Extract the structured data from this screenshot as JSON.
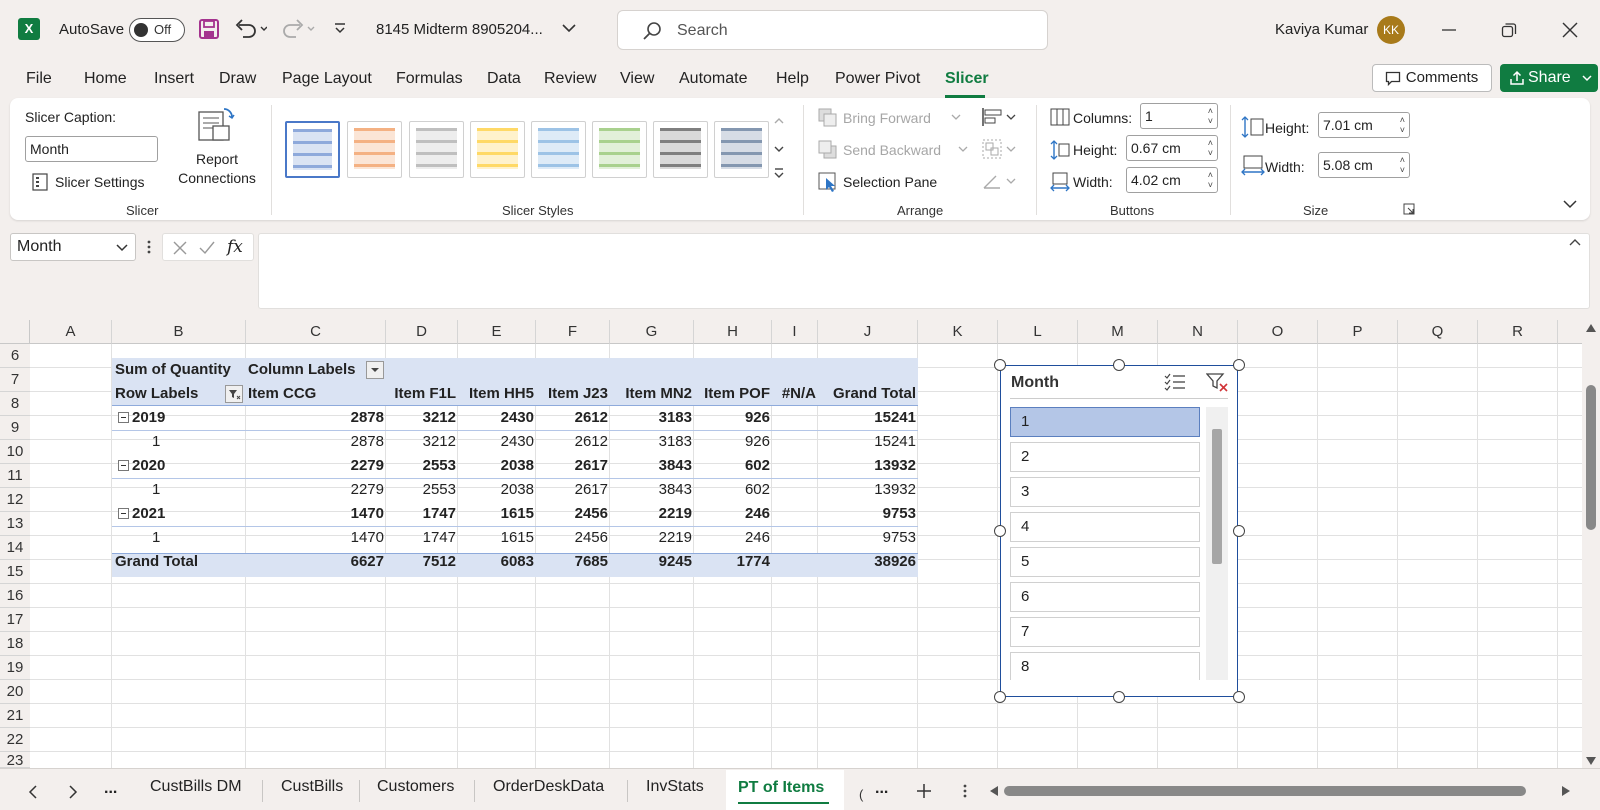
{
  "titlebar": {
    "autosave_label": "AutoSave",
    "autosave_state": "Off",
    "filename": "8145 Midterm 8905204...",
    "search_placeholder": "Search",
    "user_name": "Kaviya Kumar",
    "user_initials": "KK"
  },
  "menu": {
    "tabs": [
      "File",
      "Home",
      "Insert",
      "Draw",
      "Page Layout",
      "Formulas",
      "Data",
      "Review",
      "View",
      "Automate",
      "Help",
      "Power Pivot",
      "Slicer"
    ],
    "active": "Slicer",
    "comments": "Comments",
    "share": "Share"
  },
  "ribbon": {
    "slicer_group": {
      "caption_label": "Slicer Caption:",
      "caption_value": "Month",
      "settings": "Slicer Settings",
      "report_connections": "Report Connections",
      "label": "Slicer"
    },
    "styles_group": {
      "label": "Slicer Styles"
    },
    "arrange_group": {
      "bring_forward": "Bring Forward",
      "send_backward": "Send Backward",
      "selection_pane": "Selection Pane",
      "label": "Arrange"
    },
    "buttons_group": {
      "columns_label": "Columns:",
      "columns_value": "1",
      "height_label": "Height:",
      "height_value": "0.67 cm",
      "width_label": "Width:",
      "width_value": "4.02 cm",
      "label": "Buttons"
    },
    "size_group": {
      "height_label": "Height:",
      "height_value": "7.01 cm",
      "width_label": "Width:",
      "width_value": "5.08 cm",
      "label": "Size"
    }
  },
  "formula_bar": {
    "name_box": "Month",
    "fx": "fx"
  },
  "grid": {
    "columns": [
      "A",
      "B",
      "C",
      "D",
      "E",
      "F",
      "G",
      "H",
      "I",
      "J",
      "K",
      "L",
      "M",
      "N",
      "O",
      "P",
      "Q",
      "R"
    ],
    "rows": [
      "6",
      "7",
      "8",
      "9",
      "10",
      "11",
      "12",
      "13",
      "14",
      "15",
      "16",
      "17",
      "18",
      "19",
      "20",
      "21",
      "22",
      "23"
    ]
  },
  "pivot": {
    "sum_label": "Sum of Quantity",
    "column_labels": "Column Labels",
    "row_labels": "Row Labels",
    "headers": [
      "Item CCG",
      "Item F1L",
      "Item HH5",
      "Item J23",
      "Item MN2",
      "Item POF",
      "#N/A",
      "Grand Total"
    ],
    "rows": [
      {
        "label": "2019",
        "type": "year",
        "values": [
          "2878",
          "3212",
          "2430",
          "2612",
          "3183",
          "926",
          "",
          "15241"
        ]
      },
      {
        "label": "1",
        "type": "month",
        "values": [
          "2878",
          "3212",
          "2430",
          "2612",
          "3183",
          "926",
          "",
          "15241"
        ]
      },
      {
        "label": "2020",
        "type": "year",
        "values": [
          "2279",
          "2553",
          "2038",
          "2617",
          "3843",
          "602",
          "",
          "13932"
        ]
      },
      {
        "label": "1",
        "type": "month",
        "values": [
          "2279",
          "2553",
          "2038",
          "2617",
          "3843",
          "602",
          "",
          "13932"
        ]
      },
      {
        "label": "2021",
        "type": "year",
        "values": [
          "1470",
          "1747",
          "1615",
          "2456",
          "2219",
          "246",
          "",
          "9753"
        ]
      },
      {
        "label": "1",
        "type": "month",
        "values": [
          "1470",
          "1747",
          "1615",
          "2456",
          "2219",
          "246",
          "",
          "9753"
        ]
      },
      {
        "label": "Grand Total",
        "type": "total",
        "values": [
          "6627",
          "7512",
          "6083",
          "7685",
          "9245",
          "1774",
          "",
          "38926"
        ]
      }
    ]
  },
  "slicer": {
    "title": "Month",
    "items": [
      "1",
      "2",
      "3",
      "4",
      "5",
      "6",
      "7",
      "8"
    ],
    "selected": "1"
  },
  "sheets": {
    "tabs": [
      "CustBills DM",
      "CustBills",
      "Customers",
      "OrderDeskData",
      "InvStats",
      "PT of Items"
    ],
    "active": "PT of Items",
    "more": "..."
  }
}
